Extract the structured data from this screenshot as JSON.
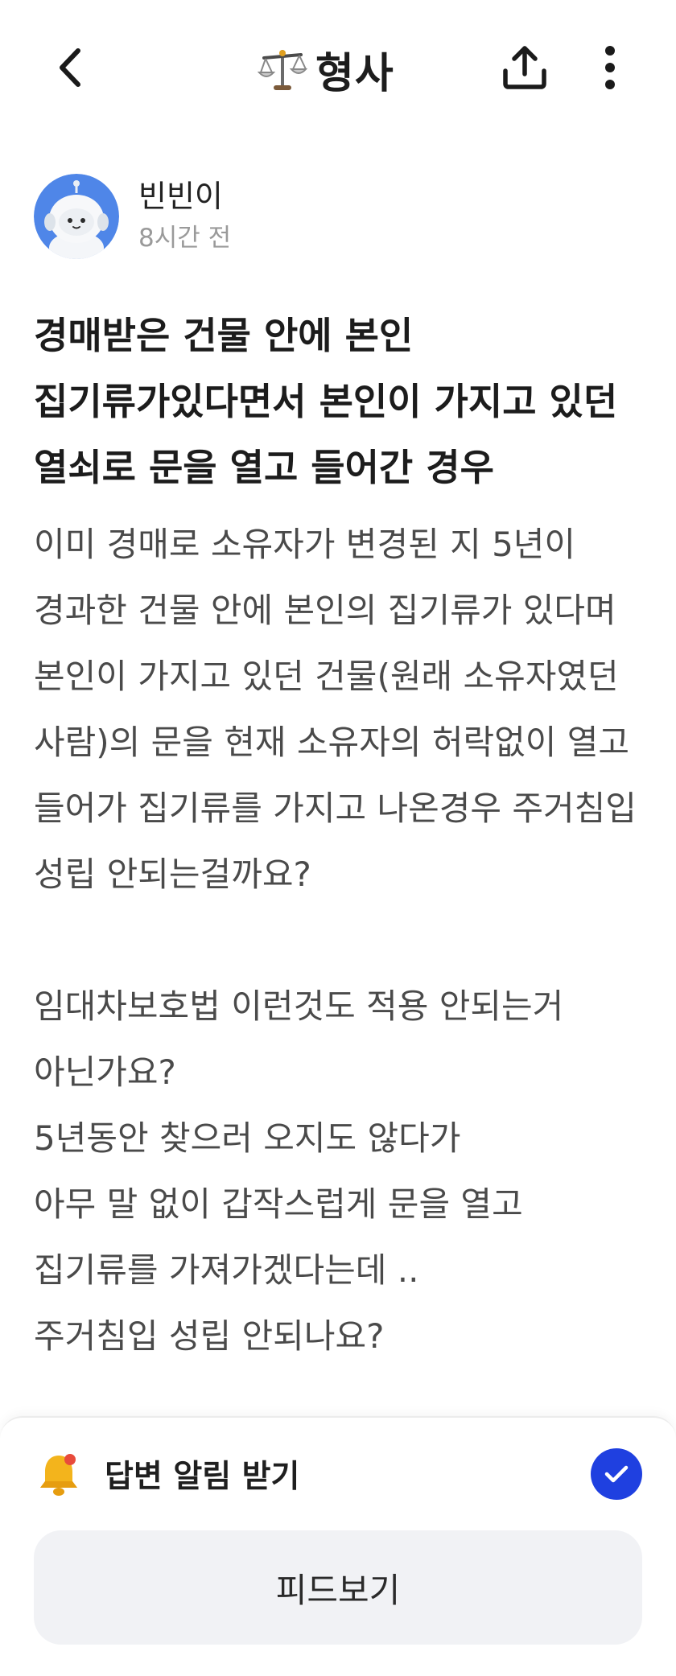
{
  "header": {
    "title": "형사",
    "title_icon": "scales-icon"
  },
  "author": {
    "name": "빈빈이",
    "time": "8시간 전"
  },
  "question": {
    "title": "경매받은 건물 안에 본인 집기류가있다면서 본인이 가지고 있던 열쇠로 문을 열고 들어간 경우",
    "paragraphs": [
      "이미 경매로 소유자가 변경된 지 5년이 경과한 건물 안에 본인의 집기류가 있다며 본인이 가지고 있던 건물(원래 소유자였던 사람)의 문을 현재 소유자의 허락없이 열고 들어가 집기류를 가지고 나온경우 주거침입 성립 안되는걸까요?",
      "임대차보호법 이런것도 적용 안되는거 아닌가요?\n5년동안 찾으러 오지도 않다가\n아무 말 없이 갑작스럽게 문을 열고 집기류를 가져가겠다는데 ..\n주거침입 성립 안되나요?"
    ]
  },
  "bottom": {
    "notify_label": "답변 알림 받기",
    "notify_checked": true,
    "feed_button": "피드보기"
  },
  "colors": {
    "accent": "#1f40e0",
    "text_primary": "#1c1c1c",
    "text_body": "#4a4a4a",
    "text_muted": "#9a9a9a",
    "button_bg": "#f1f2f5"
  }
}
